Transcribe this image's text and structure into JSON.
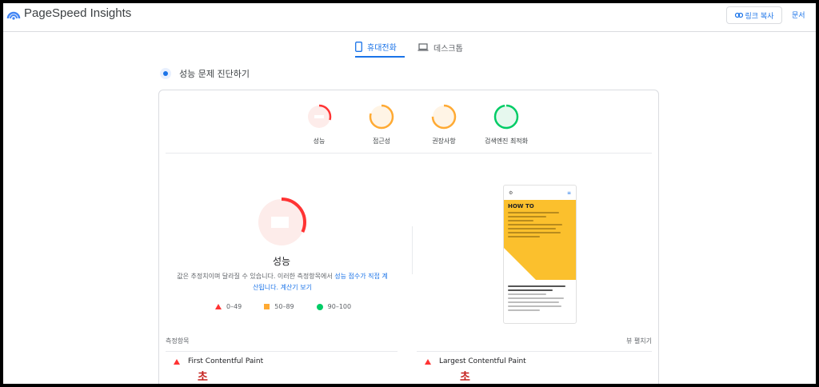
{
  "header": {
    "brand": "PageSpeed Insights",
    "copy_link": "링크 복사",
    "docs": "문서"
  },
  "tabs": [
    {
      "label": "휴대전화",
      "active": true,
      "icon": "phone-icon"
    },
    {
      "label": "데스크톱",
      "active": false,
      "icon": "laptop-icon"
    }
  ],
  "diagnose_title": "성능 문제 진단하기",
  "categories": [
    {
      "label": "성능",
      "status": "poor"
    },
    {
      "label": "접근성",
      "status": "average"
    },
    {
      "label": "권장사항",
      "status": "average"
    },
    {
      "label": "검색엔진 최적화",
      "status": "good"
    }
  ],
  "performance": {
    "label": "성능",
    "note_prefix": "값은 추정치이며 달라질 수 있습니다. 이러한 측정항목에서 ",
    "note_link": "성능 점수가 직접 계산됩니다.",
    "note_calc": " 계산기 보기"
  },
  "legend": [
    {
      "range": "0–49",
      "shape": "triangle",
      "color": "#ff3333"
    },
    {
      "range": "50–89",
      "shape": "square",
      "color": "#ffaa33"
    },
    {
      "range": "90–100",
      "shape": "circle",
      "color": "#00cc66"
    }
  ],
  "phone_preview": {
    "heading": "HOW TO"
  },
  "metrics": {
    "header": "측정항목",
    "expand": "뷰 펼치기",
    "items": [
      {
        "name": "First Contentful Paint",
        "value": "초"
      },
      {
        "name": "Largest Contentful Paint",
        "value": "초"
      }
    ]
  },
  "colors": {
    "poor": "#ff3333",
    "average": "#ffaa33",
    "good": "#00cc66",
    "accent": "#1a73e8"
  }
}
